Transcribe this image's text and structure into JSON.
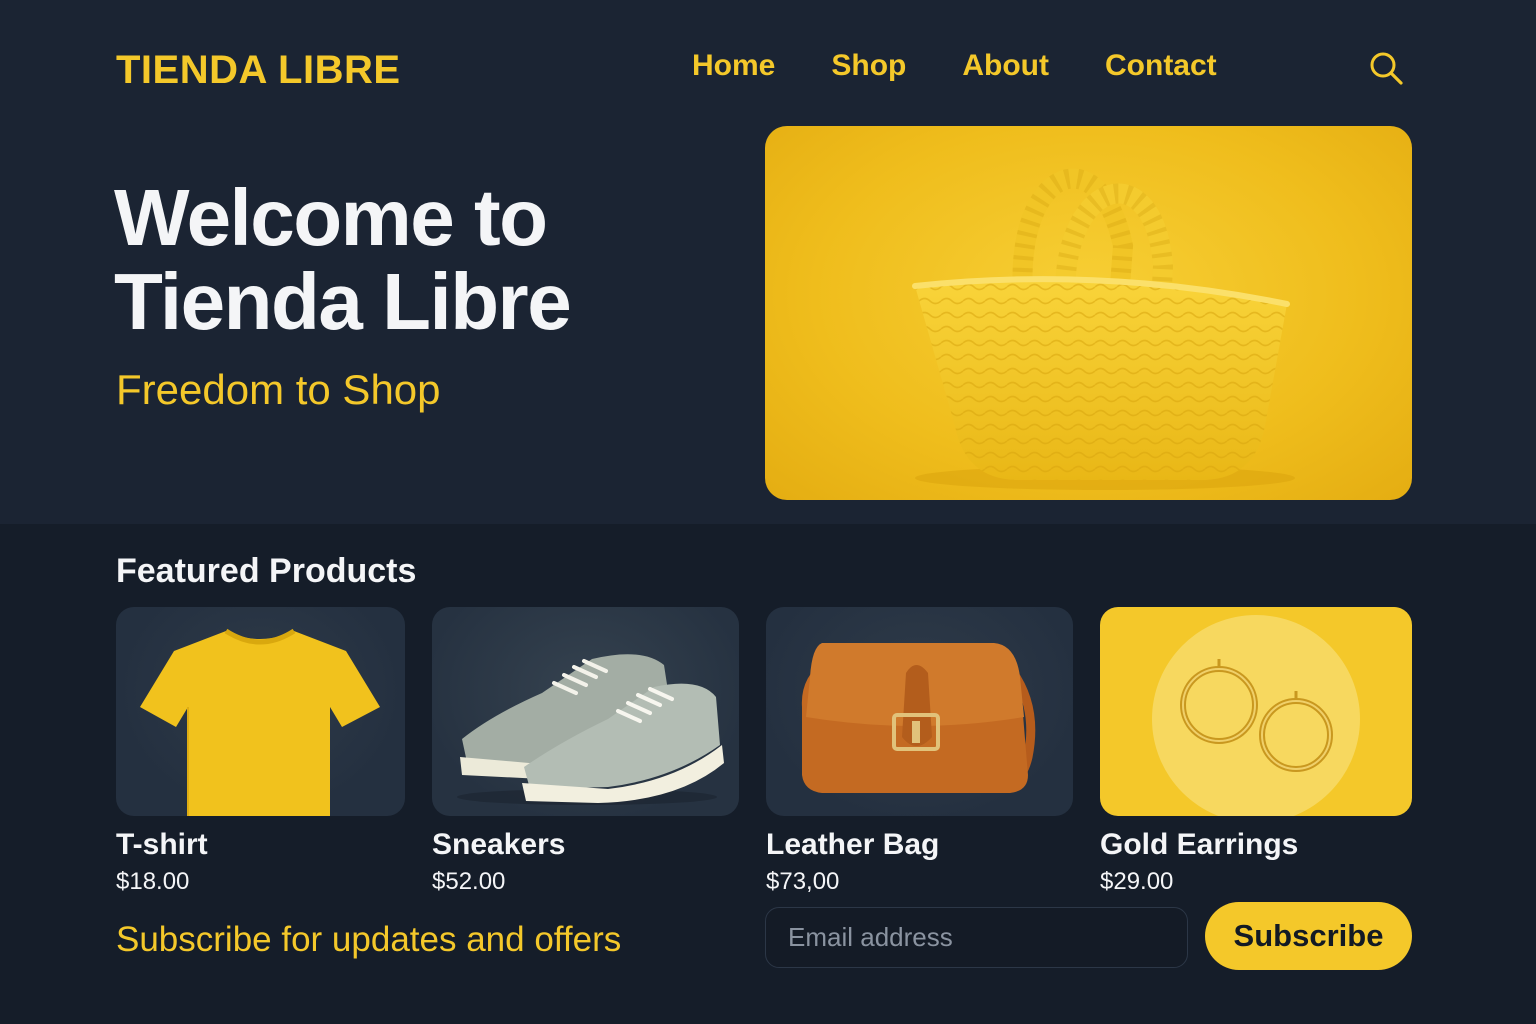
{
  "header": {
    "logo": "TIENDA LIBRE",
    "nav": [
      {
        "label": "Home"
      },
      {
        "label": "Shop"
      },
      {
        "label": "About"
      },
      {
        "label": "Contact"
      }
    ],
    "search_icon": "search-icon"
  },
  "hero": {
    "title_line1": "Welcome to",
    "title_line2": "Tienda Libre",
    "subtitle": "Freedom to Shop",
    "image": "yellow-woven-tote-bag"
  },
  "featured": {
    "title": "Featured Products",
    "products": [
      {
        "name": "T-shirt",
        "price": "$18.00",
        "image": "yellow-tshirt"
      },
      {
        "name": "Sneakers",
        "price": "$52.00",
        "image": "grey-sneakers"
      },
      {
        "name": "Leather Bag",
        "price": "$73,00",
        "image": "brown-leather-bag"
      },
      {
        "name": "Gold Earrings",
        "price": "$29.00",
        "image": "gold-hoop-earrings"
      }
    ]
  },
  "newsletter": {
    "text": "Subscribe for updates and offers",
    "email_placeholder": "Email address",
    "button_label": "Subscribe"
  },
  "colors": {
    "accent": "#f4c82a",
    "background_top": "#1b2433",
    "background_bottom": "#151d29",
    "text_light": "#f4f5f7"
  }
}
